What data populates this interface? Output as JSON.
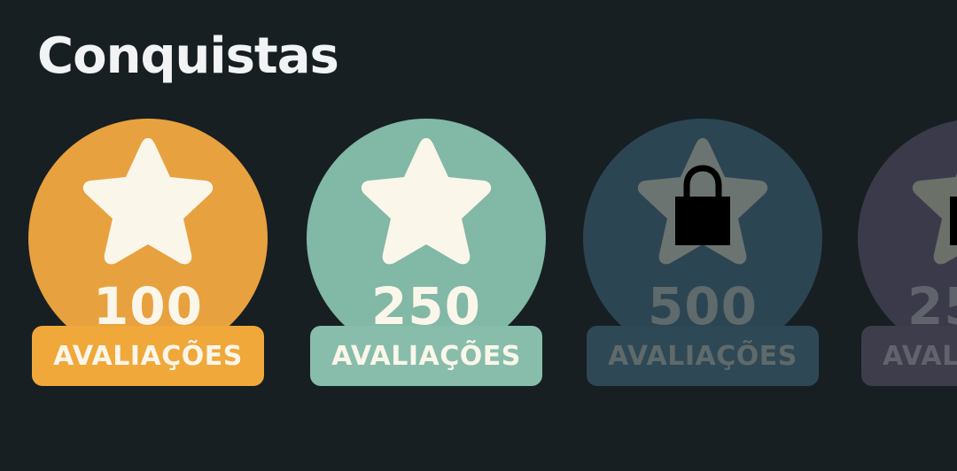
{
  "page": {
    "title": "Conquistas",
    "background": "#171f22"
  },
  "badges": [
    {
      "number": "100",
      "label": "AVALIAÇÕES",
      "state": "unlocked",
      "icon": "star-icon",
      "disc_color": "#e8a13f",
      "ribbon_color": "#f0a83a",
      "icon_color": "#fbf6ea",
      "text_color": "#fbf6ea"
    },
    {
      "number": "250",
      "label": "AVALIAÇÕES",
      "state": "unlocked",
      "icon": "star-icon",
      "disc_color": "#82b8a6",
      "ribbon_color": "#88bdab",
      "icon_color": "#fbf6ea",
      "text_color": "#fbf6ea"
    },
    {
      "number": "500",
      "label": "AVALIAÇÕES",
      "state": "locked",
      "icon": "lock-icon",
      "disc_color": "#2c4553",
      "ribbon_color": "#2f4855",
      "icon_color": "#6b7470",
      "text_color": "#5e6a6b"
    },
    {
      "number": "25",
      "label": "AVAL",
      "state": "locked",
      "icon": "lock-icon",
      "disc_color": "#3b3a4a",
      "ribbon_color": "#3e3d4c",
      "icon_color": "#6b7068",
      "text_color": "#60636b"
    }
  ]
}
